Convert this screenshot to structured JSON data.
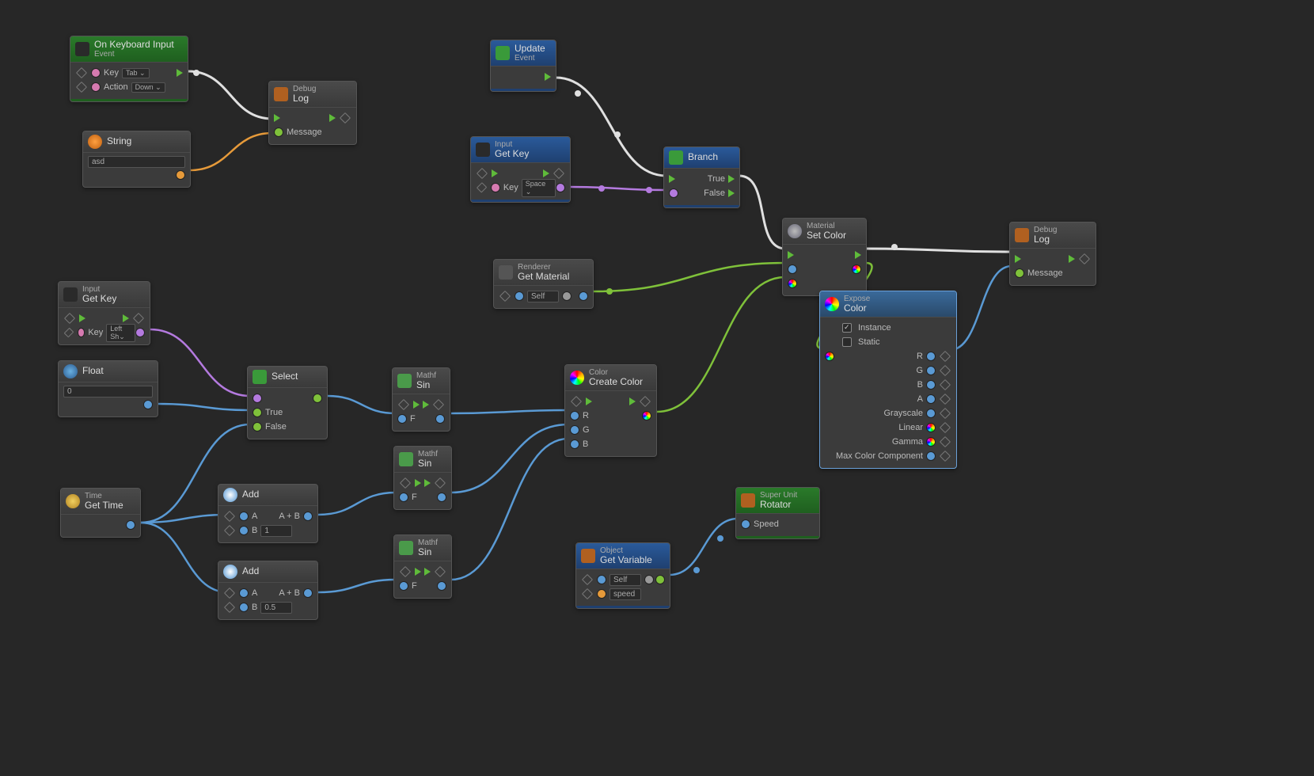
{
  "nodes": {
    "keyboardInput": {
      "sup": "On Keyboard Input",
      "ttl": "Event",
      "p1": "Key",
      "p1v": "Tab ⌄",
      "p2": "Action",
      "p2v": "Down ⌄"
    },
    "string": {
      "ttl": "String",
      "val": "asd"
    },
    "debug1": {
      "sup": "Debug",
      "ttl": "Log",
      "msg": "Message"
    },
    "update": {
      "sup": "Update",
      "ttl": "Event"
    },
    "inputGetKey1": {
      "sup": "Input",
      "ttl": "Get Key",
      "k": "Key",
      "kv": "Space ⌄"
    },
    "branch": {
      "ttl": "Branch",
      "t": "True",
      "f": "False"
    },
    "matSetColor": {
      "sup": "Material",
      "ttl": "Set Color"
    },
    "debug2": {
      "sup": "Debug",
      "ttl": "Log",
      "msg": "Message"
    },
    "rendGetMat": {
      "sup": "Renderer",
      "ttl": "Get Material",
      "self": "Self"
    },
    "exposeColor": {
      "sup": "Expose",
      "ttl": "Color",
      "inst": "Instance",
      "stat": "Static",
      "r": "R",
      "g": "G",
      "b": "B",
      "a": "A",
      "gs": "Grayscale",
      "lin": "Linear",
      "gam": "Gamma",
      "mcc": "Max Color Component"
    },
    "inputGetKey2": {
      "sup": "Input",
      "ttl": "Get Key",
      "k": "Key",
      "kv": "Left Sh⌄"
    },
    "float": {
      "ttl": "Float",
      "val": "0"
    },
    "select": {
      "ttl": "Select",
      "t": "True",
      "f": "False"
    },
    "sin1": {
      "sup": "Mathf",
      "ttl": "Sin",
      "f": "F"
    },
    "sin2": {
      "sup": "Mathf",
      "ttl": "Sin",
      "f": "F"
    },
    "sin3": {
      "sup": "Mathf",
      "ttl": "Sin",
      "f": "F"
    },
    "createColor": {
      "sup": "Color",
      "ttl": "Create Color",
      "r": "R",
      "g": "G",
      "b": "B"
    },
    "time": {
      "sup": "Time",
      "ttl": "Get Time"
    },
    "add1": {
      "ttl": "Add",
      "a": "A",
      "b": "B",
      "bv": "1",
      "out": "A + B"
    },
    "add2": {
      "ttl": "Add",
      "a": "A",
      "b": "B",
      "bv": "0.5",
      "out": "A + B"
    },
    "getVar": {
      "sup": "Object",
      "ttl": "Get Variable",
      "self": "Self",
      "name": "speed"
    },
    "rotator": {
      "sup": "Super Unit",
      "ttl": "Rotator",
      "spd": "Speed"
    }
  },
  "colors": {
    "flow": "#e0e0e0",
    "green": "#7fc13a",
    "pink": "#d67ab0",
    "orange": "#e69a3a",
    "blue": "#5a9ad4",
    "violet": "#b47adf"
  }
}
